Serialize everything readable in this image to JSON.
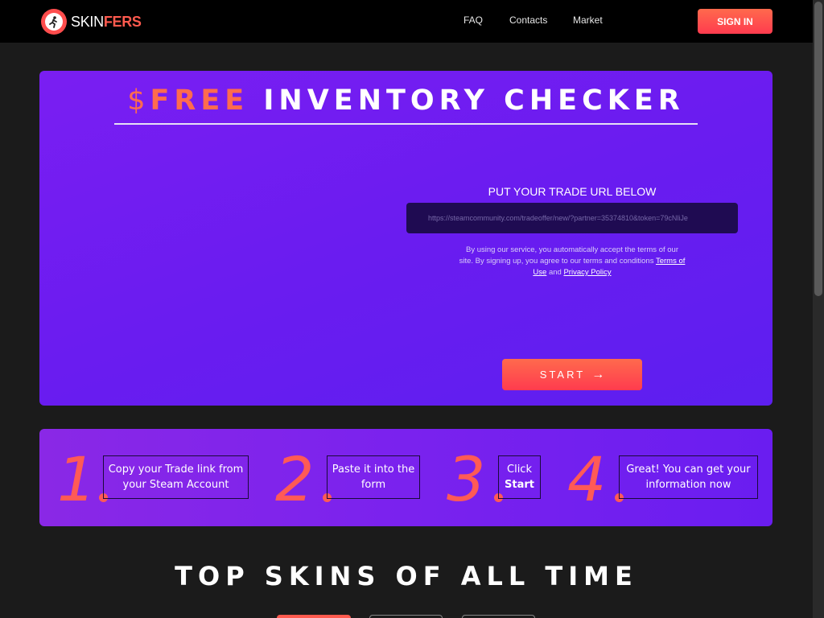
{
  "header": {
    "logo_part1": "SKIN",
    "logo_part2": "FERS",
    "nav": {
      "faq": "FAQ",
      "contacts": "Contacts",
      "market": "Market"
    },
    "signin_label": "SIGN IN"
  },
  "hero": {
    "title_symbol": "$",
    "title_accent": "FREE",
    "title_rest": " INVENTORY CHECKER",
    "trade_label": "PUT YOUR TRADE URL BELOW",
    "trade_placeholder": "https://steamcommunity.com/tradeoffer/new/?partner=35374810&token=79cNliJe",
    "terms_text": "By using our service, you automatically accept the terms of our site. By signing up, you agree to our terms and conditions",
    "terms_link": "Terms of Use",
    "terms_and": "and",
    "privacy_link": "Privacy Policy",
    "start_label": "START"
  },
  "steps": [
    {
      "num": "1",
      "line1": "Copy your Trade link from",
      "line2": "your Steam Account",
      "bold": ""
    },
    {
      "num": "2",
      "line1": "Paste it into the",
      "line2": "form",
      "bold": ""
    },
    {
      "num": "3",
      "line1": "Click",
      "line2": "",
      "bold": "Start"
    },
    {
      "num": "4",
      "line1": "Great! You can get your",
      "line2": "information now",
      "bold": ""
    }
  ],
  "section": {
    "top_skins_title": "TOP SKINS OF ALL TIME"
  },
  "colors": {
    "accent": "#ff5a4e",
    "hero_bg": "#6a1cf0",
    "header_bg": "#000000",
    "page_bg": "#1b1b1b"
  }
}
